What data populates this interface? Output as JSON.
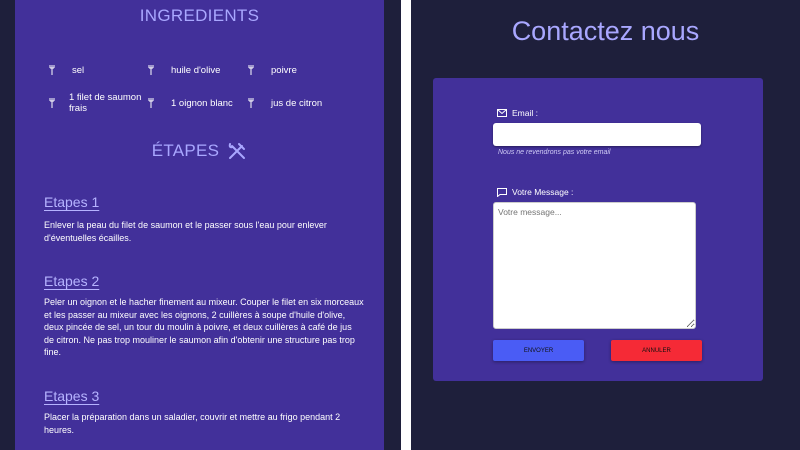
{
  "recipe": {
    "ingredients_heading": "INGREDIENTS",
    "ingredients": [
      {
        "label": "sel",
        "icon": "utensils-icon"
      },
      {
        "label": "huile d'olive",
        "icon": "utensils-icon"
      },
      {
        "label": "poivre",
        "icon": "utensils-icon"
      },
      {
        "label": "1 filet de saumon frais",
        "icon": "utensils-icon"
      },
      {
        "label": "1 oignon blanc",
        "icon": "utensils-icon"
      },
      {
        "label": "jus de citron",
        "icon": "utensils-icon"
      }
    ],
    "steps_heading": "ÉTAPES",
    "steps_icon": "fork-knife-cross-icon",
    "steps": [
      {
        "title": "Etapes 1",
        "text": "Enlever la peau du filet de saumon et le passer sous l'eau pour enlever d'éventuelles écailles."
      },
      {
        "title": "Etapes 2",
        "text": "Peler un oignon et le hacher finement au mixeur. Couper le filet en six morceaux et les passer au mixeur avec les oignons, 2 cuillères à soupe d'huile d'olive, deux pincée de sel, un tour du moulin à poivre, et deux cuillères à café de jus de citron. Ne pas trop mouliner le saumon afin d'obtenir une structure pas trop fine."
      },
      {
        "title": "Etapes 3",
        "text": "Placer la préparation dans un saladier, couvrir et mettre au frigo pendant 2 heures."
      }
    ]
  },
  "contact": {
    "title": "Contactez nous",
    "email_label": "Email :",
    "email_icon": "envelope-icon",
    "email_value": "",
    "email_hint": "Nous ne revendrons pas votre email",
    "message_label": "Votre Message :",
    "message_icon": "chat-bubble-icon",
    "message_placeholder": "Votre message...",
    "send_label": "ENVOYER",
    "cancel_label": "ANNULER"
  },
  "colors": {
    "page_bg": "#1e1f3b",
    "panel_bg": "#42309a",
    "heading": "#a9a7ff",
    "send_button": "#4a5cf5",
    "cancel_button": "#f52a36"
  }
}
